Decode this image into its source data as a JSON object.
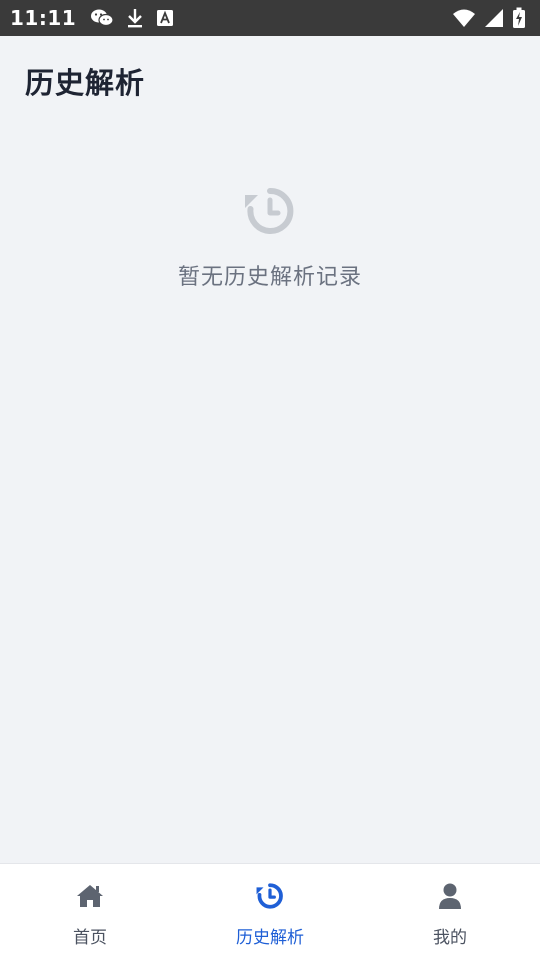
{
  "status_bar": {
    "time": "11:11",
    "left_icons": [
      "wechat-icon",
      "download-icon",
      "text-a-icon"
    ],
    "right_icons": [
      "wifi-icon",
      "signal-icon",
      "battery-charging-icon"
    ]
  },
  "header": {
    "title": "历史解析"
  },
  "empty_state": {
    "icon": "history-icon",
    "message": "暂无历史解析记录"
  },
  "bottom_nav": {
    "active_index": 1,
    "items": [
      {
        "label": "首页",
        "icon": "home-icon"
      },
      {
        "label": "历史解析",
        "icon": "history-icon"
      },
      {
        "label": "我的",
        "icon": "user-icon"
      }
    ]
  },
  "colors": {
    "background": "#f1f3f6",
    "status_bar": "#3a3a3a",
    "accent": "#1f5fd6",
    "inactive_icon": "#5d6470",
    "empty_icon": "#c7cbd1",
    "empty_text": "#6b7280"
  }
}
